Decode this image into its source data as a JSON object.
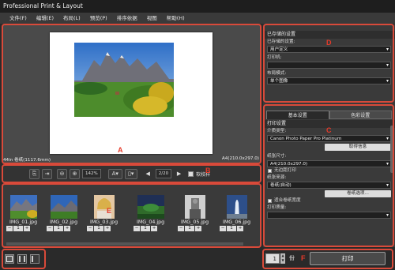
{
  "app": {
    "title": "Professional Print & Layout"
  },
  "menu": [
    "文件(F)",
    "编辑(E)",
    "布局(L)",
    "预览(P)",
    "排序依据",
    "视图",
    "帮助(H)"
  ],
  "labels": {
    "A": "A",
    "B": "B",
    "C": "C",
    "D": "D",
    "E": "E",
    "F": "F"
  },
  "preview": {
    "paper_size": "44in 卷纸(1117.6mm)",
    "print_size": "A4(210.0x297.0)"
  },
  "toolbar": {
    "zoom": "142%",
    "page": "2/20",
    "softproof": "软校样"
  },
  "thumbnails": [
    {
      "name": "IMG_01.jpg",
      "count": "1"
    },
    {
      "name": "IMG_02.jpg",
      "count": "1"
    },
    {
      "name": "IMG_03.jpg",
      "count": "1"
    },
    {
      "name": "IMG_04.jpg",
      "count": "1"
    },
    {
      "name": "IMG_05.jpg",
      "count": "1"
    },
    {
      "name": "IMG_06.jpg",
      "count": "1"
    }
  ],
  "stepper": {
    "minus": "−",
    "plus": "+"
  },
  "saved": {
    "header": "已存储的设置",
    "saved_label": "已存储的设置:",
    "saved_value": "用户定义",
    "printer_label": "打印机:",
    "layout_label": "布局模式:",
    "layout_value": "单个图像"
  },
  "tabs": {
    "basic": "基本设置",
    "color": "色彩设置"
  },
  "print": {
    "header": "打印设置",
    "media_label": "介质类型:",
    "media_value": "Canon Photo Paper Pro Platinum",
    "info_button": "取得信息",
    "paper_size_label": "纸张尺寸:",
    "paper_size_value": "A4(210.0x297.0)",
    "borderless": "无边距打印",
    "source_label": "纸张来源:",
    "source_value": "卷纸(自动)",
    "roll_button": "卷纸选项...",
    "fit_roll": "适合卷纸宽度",
    "quality_label": "打印质量:"
  },
  "bottom": {
    "copies": "1",
    "copies_unit": "份",
    "print_button": "打印"
  }
}
